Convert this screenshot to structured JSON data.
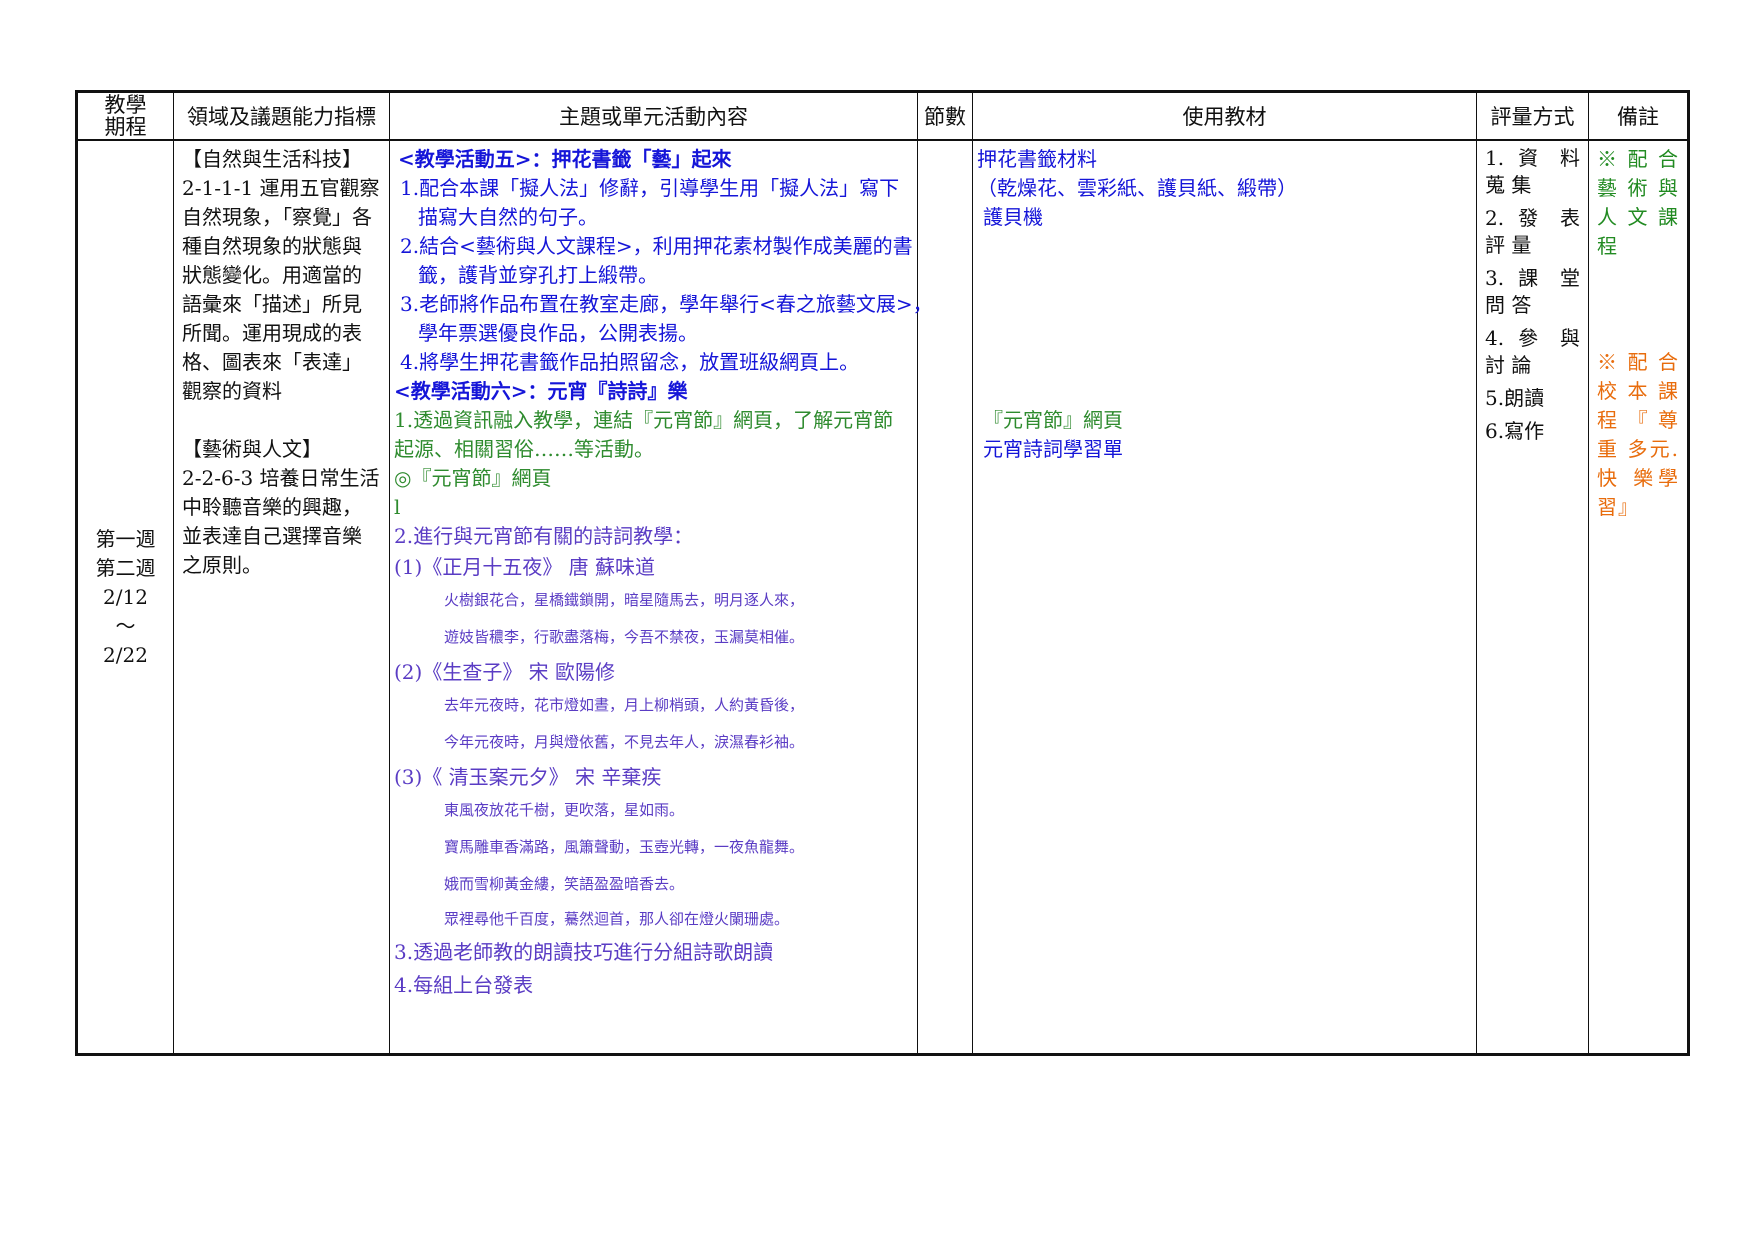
{
  "header": {
    "period": "教學\n期程",
    "period_line1": "教學",
    "period_line2": "期程",
    "indicators": "領域及議題能力指標",
    "content": "主題或單元活動內容",
    "sessions": "節數",
    "materials": "使用教材",
    "evaluation": "評量方式",
    "notes": "備註"
  },
  "row": {
    "period_lines": [
      "第一週",
      "第二週",
      "2/12",
      "～",
      "2/22"
    ],
    "indicators": {
      "science_title": "【自然與生活科技】",
      "science_text": [
        "2-1-1-1 運用五官觀察",
        "自然現象，「察覺」各",
        "種自然現象的狀態與",
        "狀態變化。用適當的",
        "語彙來「描述」所見",
        "所聞。運用現成的表",
        "格、圖表來「表達」",
        "觀察的資料"
      ],
      "arts_title": "【藝術與人文】",
      "arts_text": [
        "2-2-6-3 培養日常生活",
        "中聆聽音樂的興趣，",
        "並表達自己選擇音樂",
        "之原則。"
      ]
    },
    "content": {
      "act5_title": "<教學活動五>：押花書籤「藝」起來",
      "act5_items": [
        [
          "1.配合本課「擬人法」修辭，引導學生用「擬人法」寫下",
          "描寫大自然的句子。"
        ],
        [
          "2.結合<藝術與人文課程>，利用押花素材製作成美麗的書",
          "籤，護背並穿孔打上緞帶。"
        ],
        [
          "3.老師將作品布置在教室走廊，學年舉行<春之旅藝文展>，",
          "學年票選優良作品，公開表揚。"
        ],
        [
          "4.將學生押花書籤作品拍照留念，放置班級網頁上。"
        ]
      ],
      "act6_title": "<教學活動六>：元宵『詩詩』樂",
      "act6_item1": [
        "1.透過資訊融入教學，連結『元宵節』網頁，了解元宵節",
        "起源、相關習俗……等活動。"
      ],
      "act6_web": "◎『元宵節』網頁",
      "act6_stray": "l",
      "act6_item2": "2.進行與元宵節有關的詩詞教學：",
      "poems": [
        {
          "title": "(1)《正月十五夜》 唐 蘇味道",
          "lines": [
            "火樹銀花合，星橋鐵鎖開，暗星隨馬去，明月逐人來，",
            "遊妓皆穠李，行歌盡落梅，今吾不禁夜，玉漏莫相催。"
          ]
        },
        {
          "title": "(2)《生查子》 宋 歐陽修",
          "lines": [
            "去年元夜時，花市燈如晝，月上柳梢頭，人約黃昏後，",
            "今年元夜時，月與燈依舊，不見去年人，淚濕春衫袖。"
          ]
        },
        {
          "title": "(3)《 清玉案元夕》 宋 辛棄疾",
          "lines": [
            "東風夜放花千樹，更吹落，星如雨。",
            "寶馬雕車香滿路，風簫聲動，玉壺光轉，一夜魚龍舞。",
            "娥而雪柳黃金縷，笑語盈盈暗香去。",
            "眾裡尋他千百度，驀然迴首，那人卻在燈火闌珊處。"
          ]
        }
      ],
      "act6_item3": "3.透過老師教的朗讀技巧進行分組詩歌朗讀",
      "act6_item4": "4.每組上台發表"
    },
    "materials": {
      "m1": "押花書籤材料",
      "m2": "（乾燥花、雲彩紙、護貝紙、緞帶）",
      "m3": "護貝機",
      "m4": "『元宵節』網頁",
      "m5": "元宵詩詞學習單"
    },
    "evaluation": [
      "1. 資 料 蒐 集",
      "2. 發 表 評 量",
      "3. 課 堂 問 答",
      "4. 參 與 討 論",
      "5.朗讀",
      "6.寫作"
    ],
    "notes": {
      "note1": "※ 配 合 藝 術 與 人 文 課 程",
      "note2": "※ 配 合 校 本 課 程『尊重 多元.快 樂學習』"
    }
  },
  "colors": {
    "blue": "#1515d8",
    "green": "#2e8b2e",
    "purple": "#5a3cc4",
    "orange": "#e86c0c"
  }
}
